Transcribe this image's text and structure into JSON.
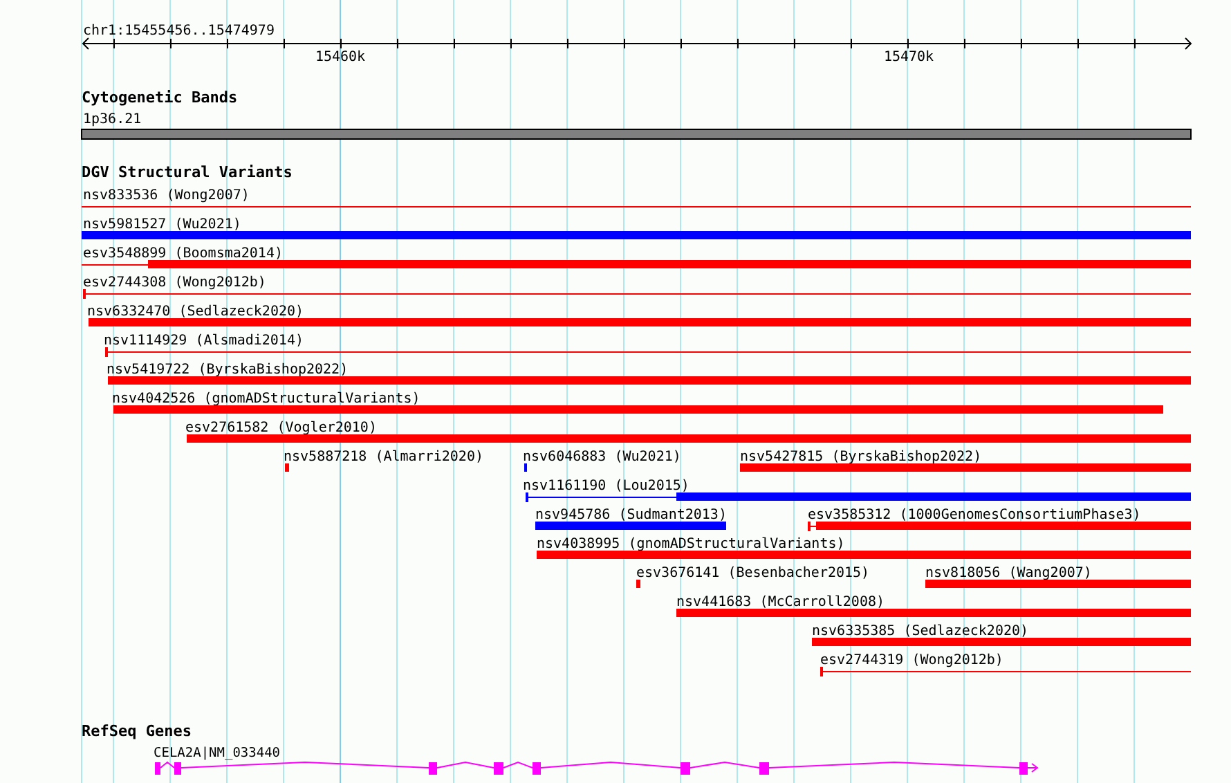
{
  "location": "chr1:15455456..15474979",
  "ruler": {
    "tick_labels": [
      "15460k",
      "15470k"
    ]
  },
  "tracks": [
    {
      "kind": "bands",
      "title": "Cytogenetic Bands",
      "band_label": "1p36.21"
    },
    {
      "kind": "variants",
      "title": "DGV Structural Variants",
      "rows": [
        [
          {
            "label": "nsv833536 (Wong2007)",
            "color": "#ff0000"
          }
        ],
        [
          {
            "label": "nsv5981527 (Wu2021)",
            "color": "#0000ff"
          }
        ],
        [
          {
            "label": "esv3548899 (Boomsma2014)",
            "color": "#ff0000"
          }
        ],
        [
          {
            "label": "esv2744308 (Wong2012b)",
            "color": "#ff0000"
          }
        ],
        [
          {
            "label": "nsv6332470 (Sedlazeck2020)",
            "color": "#ff0000"
          }
        ],
        [
          {
            "label": "nsv1114929 (Alsmadi2014)",
            "color": "#ff0000"
          }
        ],
        [
          {
            "label": "nsv5419722 (ByrskaBishop2022)",
            "color": "#ff0000"
          }
        ],
        [
          {
            "label": "nsv4042526 (gnomADStructuralVariants)",
            "color": "#ff0000"
          }
        ],
        [
          {
            "label": "esv2761582 (Vogler2010)",
            "color": "#ff0000"
          }
        ],
        [
          {
            "label": "nsv5887218 (Almarri2020)",
            "color": "#ff0000"
          },
          {
            "label": "nsv6046883 (Wu2021)",
            "color": "#0000ff"
          },
          {
            "label": "nsv5427815 (ByrskaBishop2022)",
            "color": "#ff0000"
          }
        ],
        [
          {
            "label": "nsv1161190 (Lou2015)",
            "color": "#0000ff"
          }
        ],
        [
          {
            "label": "nsv945786 (Sudmant2013)",
            "color": "#0000ff"
          },
          {
            "label": "esv3585312 (1000GenomesConsortiumPhase3)",
            "color": "#ff0000"
          }
        ],
        [
          {
            "label": "nsv4038995 (gnomADStructuralVariants)",
            "color": "#ff0000"
          }
        ],
        [
          {
            "label": "esv3676141 (Besenbacher2015)",
            "color": "#ff0000"
          },
          {
            "label": "nsv818056 (Wang2007)",
            "color": "#ff0000"
          }
        ],
        [
          {
            "label": "nsv441683 (McCarroll2008)",
            "color": "#ff0000"
          }
        ],
        [
          {
            "label": "nsv6335385 (Sedlazeck2020)",
            "color": "#ff0000"
          }
        ],
        [
          {
            "label": "esv2744319 (Wong2012b)",
            "color": "#ff0000"
          }
        ]
      ]
    },
    {
      "kind": "genes",
      "title": "RefSeq Genes",
      "genes": [
        {
          "label": "CELA2A|NM_033440",
          "color": "#ff00ff"
        }
      ]
    }
  ]
}
